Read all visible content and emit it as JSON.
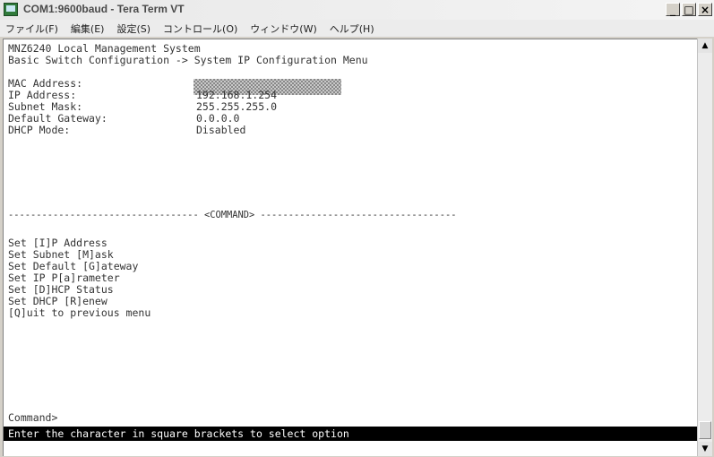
{
  "window": {
    "title": "COM1:9600baud - Tera Term VT",
    "buttons": {
      "minimize": "_",
      "maximize": "□",
      "close": "×"
    }
  },
  "menu": {
    "items": [
      "ファイル(F)",
      "編集(E)",
      "設定(S)",
      "コントロール(O)",
      "ウィンドウ(W)",
      "ヘルプ(H)"
    ]
  },
  "terminal": {
    "header_line1": "MNZ6240 Local Management System",
    "header_line2": "Basic Switch Configuration -> System IP Configuration Menu",
    "fields": [
      {
        "label": "MAC Address:",
        "value": ""
      },
      {
        "label": "IP Address:",
        "value": "192.168.1.254"
      },
      {
        "label": "Subnet Mask:",
        "value": "255.255.255.0"
      },
      {
        "label": "Default Gateway:",
        "value": "0.0.0.0"
      },
      {
        "label": "DHCP Mode:",
        "value": "Disabled"
      }
    ],
    "separator": "---------------------------------- <COMMAND> -----------------------------------",
    "commands": [
      "Set [I]P Address",
      "Set Subnet [M]ask",
      "Set Default [G]ateway",
      "Set IP P[a]rameter",
      "Set [D]HCP Status",
      "Set DHCP [R]enew",
      "[Q]uit to previous menu"
    ],
    "prompt": "Command>",
    "status": "Enter the character in square brackets to select option"
  },
  "scrollbar": {
    "up_arrow": "▲",
    "down_arrow": "▼"
  }
}
